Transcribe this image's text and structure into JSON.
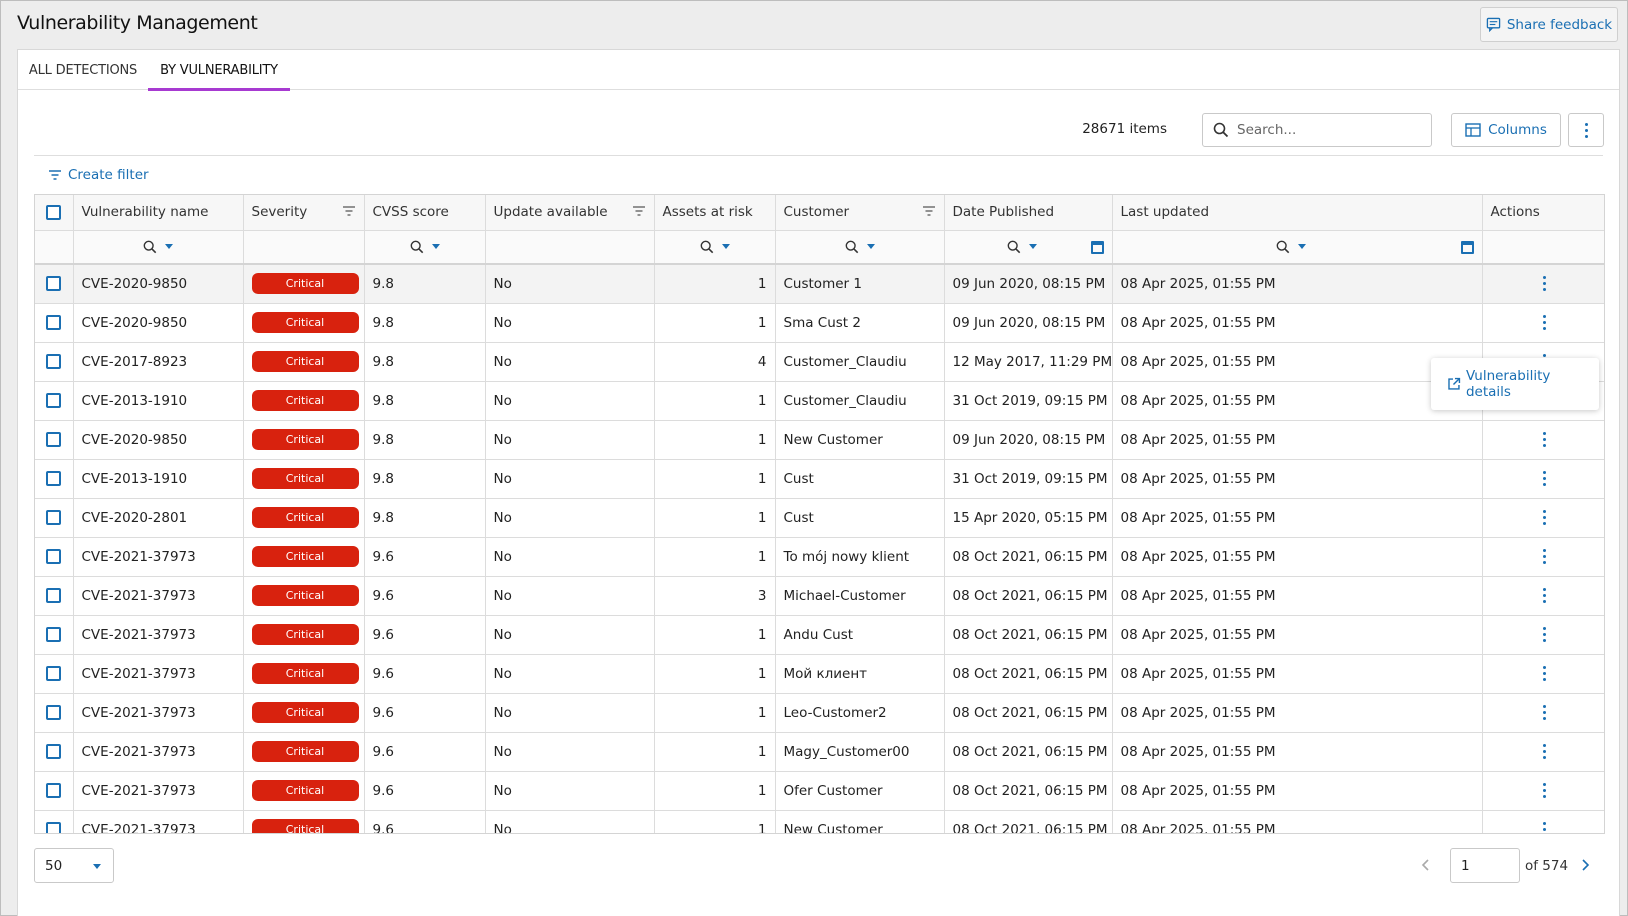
{
  "app": {
    "title": "Vulnerability Management",
    "feedback_label": "Share feedback"
  },
  "tabs": [
    {
      "label": "ALL DETECTIONS",
      "active": false
    },
    {
      "label": "BY VULNERABILITY",
      "active": true
    }
  ],
  "toolbar": {
    "items_count": "28671 items",
    "search_placeholder": "Search...",
    "columns_label": "Columns",
    "create_filter_label": "Create filter"
  },
  "columns": [
    "Vulnerability name",
    "Severity",
    "CVSS score",
    "Update available",
    "Assets at risk",
    "Customer",
    "Date Published",
    "Last updated",
    "Actions"
  ],
  "rows": [
    {
      "name": "CVE-2020-9850",
      "severity": "Critical",
      "cvss": "9.8",
      "update": "No",
      "assets": "1",
      "customer": "Customer 1",
      "published": "09 Jun 2020, 08:15 PM",
      "updated": "08 Apr 2025, 01:55 PM"
    },
    {
      "name": "CVE-2020-9850",
      "severity": "Critical",
      "cvss": "9.8",
      "update": "No",
      "assets": "1",
      "customer": "Sma Cust 2",
      "published": "09 Jun 2020, 08:15 PM",
      "updated": "08 Apr 2025, 01:55 PM"
    },
    {
      "name": "CVE-2017-8923",
      "severity": "Critical",
      "cvss": "9.8",
      "update": "No",
      "assets": "4",
      "customer": "Customer_Claudiu",
      "published": "12 May 2017, 11:29 PM",
      "updated": "08 Apr 2025, 01:55 PM"
    },
    {
      "name": "CVE-2013-1910",
      "severity": "Critical",
      "cvss": "9.8",
      "update": "No",
      "assets": "1",
      "customer": "Customer_Claudiu",
      "published": "31 Oct 2019, 09:15 PM",
      "updated": "08 Apr 2025, 01:55 PM"
    },
    {
      "name": "CVE-2020-9850",
      "severity": "Critical",
      "cvss": "9.8",
      "update": "No",
      "assets": "1",
      "customer": "New Customer",
      "published": "09 Jun 2020, 08:15 PM",
      "updated": "08 Apr 2025, 01:55 PM"
    },
    {
      "name": "CVE-2013-1910",
      "severity": "Critical",
      "cvss": "9.8",
      "update": "No",
      "assets": "1",
      "customer": "Cust",
      "published": "31 Oct 2019, 09:15 PM",
      "updated": "08 Apr 2025, 01:55 PM"
    },
    {
      "name": "CVE-2020-2801",
      "severity": "Critical",
      "cvss": "9.8",
      "update": "No",
      "assets": "1",
      "customer": "Cust",
      "published": "15 Apr 2020, 05:15 PM",
      "updated": "08 Apr 2025, 01:55 PM"
    },
    {
      "name": "CVE-2021-37973",
      "severity": "Critical",
      "cvss": "9.6",
      "update": "No",
      "assets": "1",
      "customer": "To mój nowy klient",
      "published": "08 Oct 2021, 06:15 PM",
      "updated": "08 Apr 2025, 01:55 PM"
    },
    {
      "name": "CVE-2021-37973",
      "severity": "Critical",
      "cvss": "9.6",
      "update": "No",
      "assets": "3",
      "customer": "Michael-Customer",
      "published": "08 Oct 2021, 06:15 PM",
      "updated": "08 Apr 2025, 01:55 PM"
    },
    {
      "name": "CVE-2021-37973",
      "severity": "Critical",
      "cvss": "9.6",
      "update": "No",
      "assets": "1",
      "customer": "Andu Cust",
      "published": "08 Oct 2021, 06:15 PM",
      "updated": "08 Apr 2025, 01:55 PM"
    },
    {
      "name": "CVE-2021-37973",
      "severity": "Critical",
      "cvss": "9.6",
      "update": "No",
      "assets": "1",
      "customer": "Мой клиент",
      "published": "08 Oct 2021, 06:15 PM",
      "updated": "08 Apr 2025, 01:55 PM"
    },
    {
      "name": "CVE-2021-37973",
      "severity": "Critical",
      "cvss": "9.6",
      "update": "No",
      "assets": "1",
      "customer": "Leo-Customer2",
      "published": "08 Oct 2021, 06:15 PM",
      "updated": "08 Apr 2025, 01:55 PM"
    },
    {
      "name": "CVE-2021-37973",
      "severity": "Critical",
      "cvss": "9.6",
      "update": "No",
      "assets": "1",
      "customer": "Magy_Customer00",
      "published": "08 Oct 2021, 06:15 PM",
      "updated": "08 Apr 2025, 01:55 PM"
    },
    {
      "name": "CVE-2021-37973",
      "severity": "Critical",
      "cvss": "9.6",
      "update": "No",
      "assets": "1",
      "customer": "Ofer Customer",
      "published": "08 Oct 2021, 06:15 PM",
      "updated": "08 Apr 2025, 01:55 PM"
    },
    {
      "name": "CVE-2021-37973",
      "severity": "Critical",
      "cvss": "9.6",
      "update": "No",
      "assets": "1",
      "customer": "New Customer",
      "published": "08 Oct 2021, 06:15 PM",
      "updated": "08 Apr 2025, 01:55 PM"
    }
  ],
  "row_menu": {
    "label": "Vulnerability details"
  },
  "pagination": {
    "page_size": "50",
    "current_page": "1",
    "of_label": "of 574"
  },
  "colors": {
    "accent": "#1a6fb3",
    "critical": "#d8220e",
    "tab_active": "#a73ad1"
  }
}
